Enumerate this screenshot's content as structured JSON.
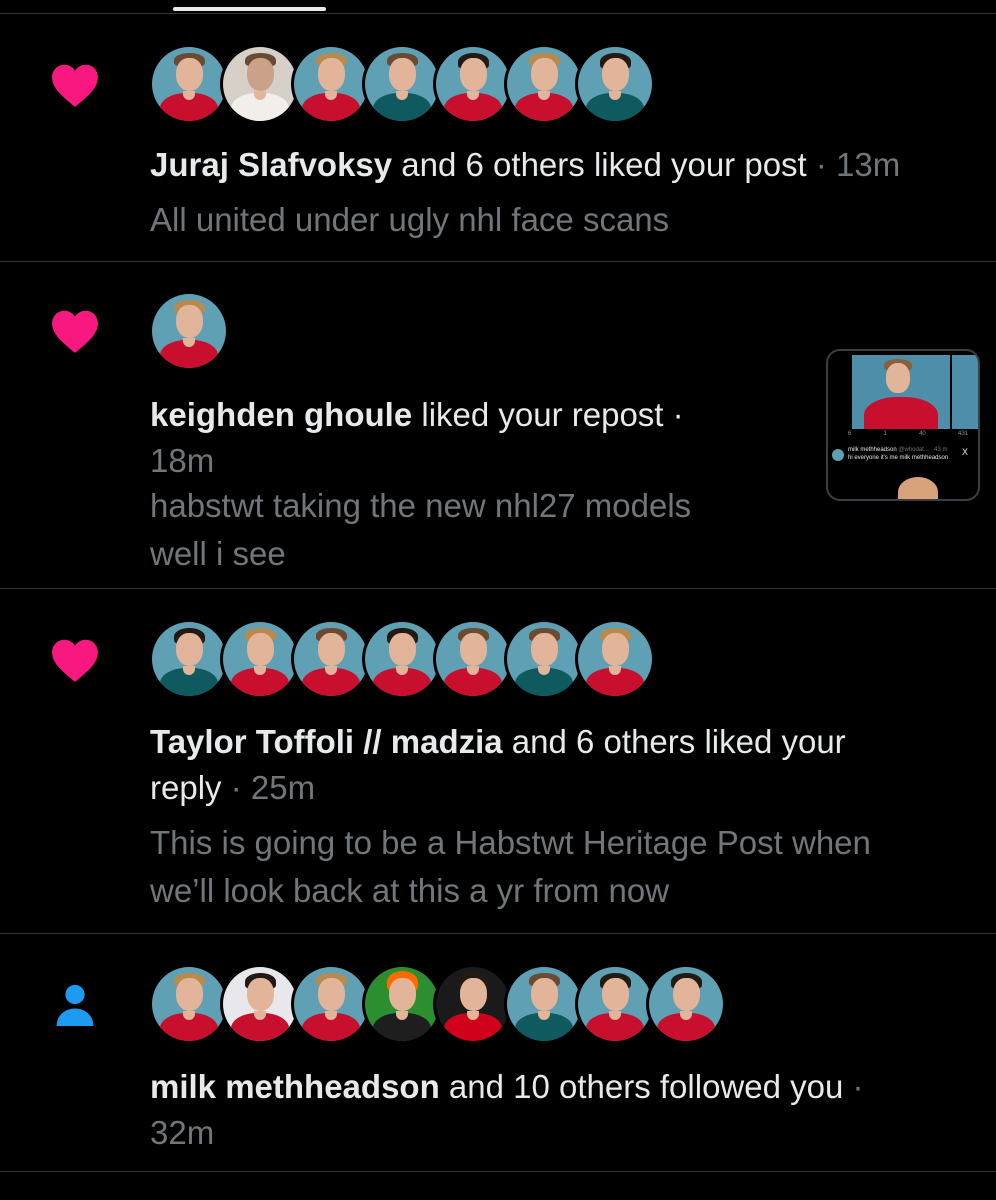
{
  "colors": {
    "background": "#000000",
    "like": "#f91880",
    "follow": "#1d9bf0",
    "text": "#e7e9ea",
    "muted": "#71767b",
    "divider": "#2f3336"
  },
  "notifications": [
    {
      "type_icon": "heart-icon",
      "actor": "Juraj Slafvoksy",
      "action": " and 6 others liked your post",
      "time": " · 13m",
      "preview": "All united under ugly nhl face scans"
    },
    {
      "type_icon": "heart-icon",
      "actor": "keighden ghoule",
      "action": " liked your repost ·",
      "time": "18m",
      "preview_line1": "habstwt taking the new nhl27 models",
      "preview_line2": "well i see",
      "thumbnail": {
        "stats": [
          "6",
          "1",
          "40",
          "431"
        ],
        "author": "milk methheadson",
        "handle": "@whodat...",
        "time": "· 43 m",
        "close": "X",
        "text": "hi everyone it's me milk methheadson"
      }
    },
    {
      "type_icon": "heart-icon",
      "actor": "Taylor Toffoli // madzia",
      "action": " and 6 others liked your",
      "action2": "reply",
      "time": " · 25m",
      "preview_line1": "This is going to be a Habstwt Heritage Post when",
      "preview_line2": "we’ll look back at this a yr from now"
    },
    {
      "type_icon": "person-icon",
      "actor": "milk methheadson",
      "action": " and 10 others followed you",
      "time_sep": " ·",
      "time": "32m"
    }
  ]
}
